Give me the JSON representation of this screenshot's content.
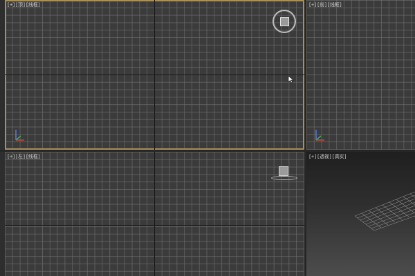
{
  "viewports": [
    {
      "id": "top-left",
      "label_parts": [
        "[+]",
        "[顶]",
        "[线框]"
      ],
      "active": true
    },
    {
      "id": "top-right",
      "label_parts": [
        "[+]",
        "[前]",
        "[线框]"
      ],
      "active": false
    },
    {
      "id": "bottom-left",
      "label_parts": [
        "[+]",
        "[左]",
        "[线框]"
      ],
      "active": false
    },
    {
      "id": "bottom-right",
      "label_parts": [
        "[+]",
        "[透视]",
        "[真实]"
      ],
      "active": false
    }
  ],
  "colors": {
    "active_border": "#a8915a",
    "grid_line": "#787878",
    "axis": "#181818",
    "viewport_bg": "#3b3b3b"
  },
  "icons": {
    "viewcube": "viewcube-icon",
    "axis_tripod": "axis-tripod-icon",
    "cursor": "mouse-cursor-icon"
  }
}
